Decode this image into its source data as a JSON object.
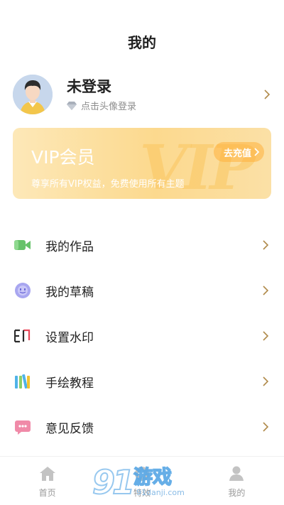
{
  "header": {
    "title": "我的"
  },
  "user": {
    "name": "未登录",
    "hint": "点击头像登录"
  },
  "vip": {
    "title": "VIP会员",
    "description": "尊享所有VIP权益，免费使用所有主题",
    "recharge_label": "去充值",
    "bg_text": "VIP"
  },
  "menu": {
    "items": [
      {
        "label": "我的作品",
        "icon": "video-camera-icon"
      },
      {
        "label": "我的草稿",
        "icon": "draft-face-icon"
      },
      {
        "label": "设置水印",
        "icon": "watermark-icon"
      },
      {
        "label": "手绘教程",
        "icon": "books-icon"
      },
      {
        "label": "意见反馈",
        "icon": "feedback-chat-icon"
      }
    ]
  },
  "tabbar": {
    "items": [
      {
        "label": "首页",
        "icon": "home-icon"
      },
      {
        "label": "特效",
        "icon": "effects-icon"
      },
      {
        "label": "我的",
        "icon": "user-icon"
      }
    ]
  },
  "watermark": {
    "number": "91",
    "text": "游戏",
    "url": "91danji.com"
  },
  "colors": {
    "accent": "#fcd98e",
    "chevron": "#b08a4a",
    "text": "#222222"
  }
}
